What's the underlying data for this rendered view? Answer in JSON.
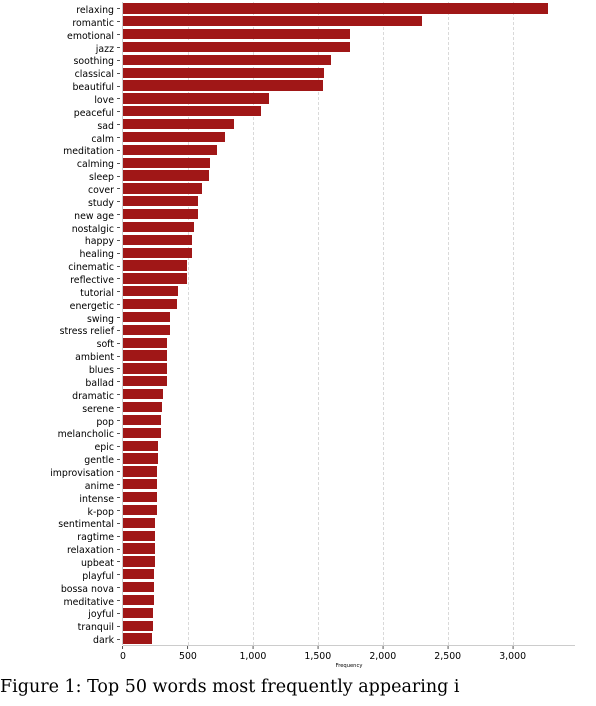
{
  "figure": {
    "caption": "Figure 1: Top 50 words most frequently appearing i"
  },
  "chart_data": {
    "type": "bar",
    "orientation": "horizontal",
    "title": "",
    "xlabel": "Frequency",
    "ylabel": "",
    "xlim": [
      0,
      3480
    ],
    "xticks": [
      0,
      500,
      1000,
      1500,
      2000,
      2500,
      3000
    ],
    "xticklabels": [
      "0",
      "500",
      "1,000",
      "1,500",
      "2,000",
      "2,500",
      "3,000"
    ],
    "grid": "vertical-dashed",
    "legend": null,
    "bar_color": "#A01717",
    "categories": [
      "relaxing",
      "romantic",
      "emotional",
      "jazz",
      "soothing",
      "classical",
      "beautiful",
      "love",
      "peaceful",
      "sad",
      "calm",
      "meditation",
      "calming",
      "sleep",
      "cover",
      "study",
      "new age",
      "nostalgic",
      "happy",
      "healing",
      "cinematic",
      "reflective",
      "tutorial",
      "energetic",
      "swing",
      "stress relief",
      "soft",
      "ambient",
      "blues",
      "ballad",
      "dramatic",
      "serene",
      "pop",
      "melancholic",
      "epic",
      "gentle",
      "improvisation",
      "anime",
      "intense",
      "k-pop",
      "sentimental",
      "ragtime",
      "relaxation",
      "upbeat",
      "playful",
      "bossa nova",
      "meditative",
      "joyful",
      "tranquil",
      "dark"
    ],
    "values": [
      3270,
      2300,
      1750,
      1750,
      1600,
      1545,
      1540,
      1125,
      1060,
      855,
      785,
      725,
      670,
      665,
      610,
      580,
      575,
      545,
      535,
      530,
      495,
      490,
      420,
      415,
      365,
      360,
      340,
      340,
      335,
      335,
      310,
      300,
      295,
      290,
      270,
      268,
      265,
      262,
      260,
      258,
      250,
      248,
      246,
      244,
      242,
      240,
      238,
      230,
      228,
      222
    ]
  }
}
